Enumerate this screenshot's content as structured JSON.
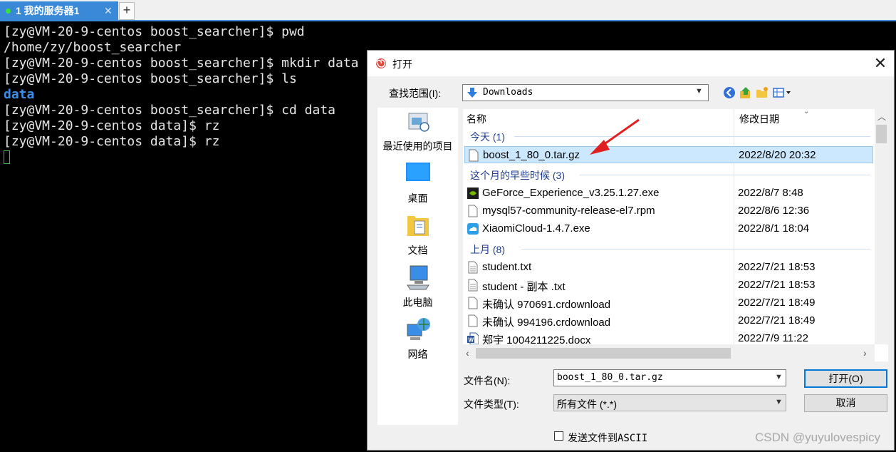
{
  "tabs": {
    "active_label": "1 我的服务器1",
    "close_glyph": "✕",
    "new_tab_glyph": "+"
  },
  "terminal": {
    "lines": [
      "[zy@VM-20-9-centos boost_searcher]$ pwd",
      "/home/zy/boost_searcher",
      "[zy@VM-20-9-centos boost_searcher]$ mkdir data",
      "[zy@VM-20-9-centos boost_searcher]$ ls",
      "data",
      "[zy@VM-20-9-centos boost_searcher]$ cd data",
      "[zy@VM-20-9-centos data]$ rz",
      "[zy@VM-20-9-centos data]$ rz"
    ]
  },
  "dialog": {
    "title": "打开",
    "close_glyph": "✕",
    "look_in_label": "查找范围(I):",
    "look_in_value": "Downloads",
    "places": [
      "最近使用的项目",
      "桌面",
      "文档",
      "此电脑",
      "网络"
    ],
    "columns": {
      "name": "名称",
      "date": "修改日期"
    },
    "groups": {
      "today": "今天 (1)",
      "earlier_this_month": "这个月的早些时候 (3)",
      "last_month": "上月 (8)"
    },
    "files": [
      {
        "name": "boost_1_80_0.tar.gz",
        "date": "2022/8/20 20:32",
        "icon": "file-icon",
        "selected": true
      },
      {
        "name": "GeForce_Experience_v3.25.1.27.exe",
        "date": "2022/8/7 8:48",
        "icon": "nvidia-icon"
      },
      {
        "name": "mysql57-community-release-el7.rpm",
        "date": "2022/8/6 12:36",
        "icon": "file-icon"
      },
      {
        "name": "XiaomiCloud-1.4.7.exe",
        "date": "2022/8/1 18:04",
        "icon": "cloud-icon"
      },
      {
        "name": "student.txt",
        "date": "2022/7/21 18:53",
        "icon": "text-file-icon"
      },
      {
        "name": "student - 副本 .txt",
        "date": "2022/7/21 18:53",
        "icon": "text-file-icon"
      },
      {
        "name": "未确认 970691.crdownload",
        "date": "2022/7/21 18:49",
        "icon": "file-icon"
      },
      {
        "name": "未确认 994196.crdownload",
        "date": "2022/7/21 18:49",
        "icon": "file-icon"
      },
      {
        "name": "郑宇 1004211225.docx",
        "date": "2022/7/9 11:22",
        "icon": "word-icon"
      }
    ],
    "file_name_label": "文件名(N):",
    "file_name_value": "boost_1_80_0.tar.gz",
    "file_type_label": "文件类型(T):",
    "file_type_value": "所有文件 (*.*)",
    "open_button": "打开(O)",
    "cancel_button": "取消",
    "ascii_checkbox_label": "发送文件到ASCII"
  },
  "watermark": "CSDN @yuyulovespicy",
  "colors": {
    "tab_active": "#3a88d8",
    "terminal_bg": "#000000",
    "dir_blue": "#3b8eea",
    "selection": "#cce8ff",
    "arrow_red": "#e02020"
  }
}
